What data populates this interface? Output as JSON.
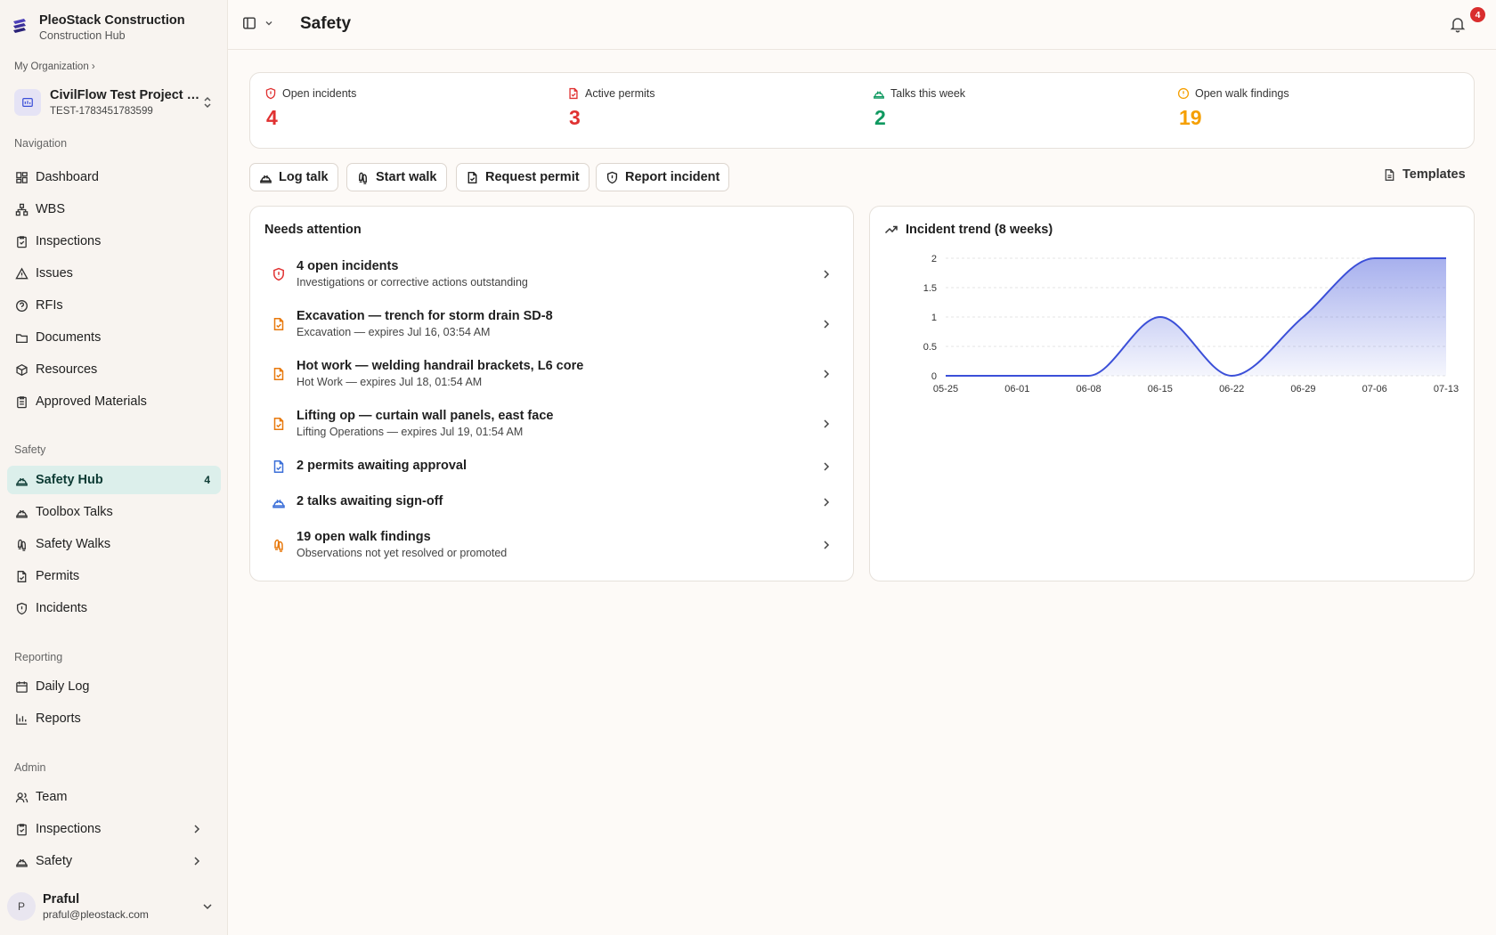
{
  "brand": {
    "name": "PleoStack Construction",
    "subtitle": "Construction Hub"
  },
  "org": {
    "crumb": "My Organization ›"
  },
  "project": {
    "name": "CivilFlow Test Project (U...",
    "code": "TEST-1783451783599"
  },
  "sidebar": {
    "navigation_label": "Navigation",
    "navigation": [
      "Dashboard",
      "WBS",
      "Inspections",
      "Issues",
      "RFIs",
      "Documents",
      "Resources",
      "Approved Materials"
    ],
    "safety_label": "Safety",
    "safety": [
      "Safety Hub",
      "Toolbox Talks",
      "Safety Walks",
      "Permits",
      "Incidents"
    ],
    "safety_hub_count": "4",
    "reporting_label": "Reporting",
    "reporting": [
      "Daily Log",
      "Reports"
    ],
    "admin_label": "Admin",
    "admin": [
      "Team",
      "Inspections",
      "Safety"
    ]
  },
  "user": {
    "initial": "P",
    "name": "Praful",
    "email": "praful@pleostack.com"
  },
  "header": {
    "title": "Safety",
    "notification_count": "4"
  },
  "stats": [
    {
      "label": "Open incidents",
      "value": "4",
      "color": "#e03131"
    },
    {
      "label": "Active permits",
      "value": "3",
      "color": "#e03131"
    },
    {
      "label": "Talks this week",
      "value": "2",
      "color": "#0f9960"
    },
    {
      "label": "Open walk findings",
      "value": "19",
      "color": "#f59f00"
    }
  ],
  "actions": {
    "log_talk": "Log talk",
    "start_walk": "Start walk",
    "request_permit": "Request permit",
    "report_incident": "Report incident",
    "templates": "Templates"
  },
  "attention": {
    "title": "Needs attention",
    "items": [
      {
        "title": "4 open incidents",
        "subtitle": "Investigations or corrective actions outstanding"
      },
      {
        "title": "Excavation — trench for storm drain SD-8",
        "subtitle": "Excavation — expires Jul 16, 03:54 AM"
      },
      {
        "title": "Hot work — welding handrail brackets, L6 core",
        "subtitle": "Hot Work — expires Jul 18, 01:54 AM"
      },
      {
        "title": "Lifting op — curtain wall panels, east face",
        "subtitle": "Lifting Operations — expires Jul 19, 01:54 AM"
      },
      {
        "title": "2 permits awaiting approval",
        "subtitle": ""
      },
      {
        "title": "2 talks awaiting sign-off",
        "subtitle": ""
      },
      {
        "title": "19 open walk findings",
        "subtitle": "Observations not yet resolved or promoted"
      }
    ]
  },
  "chart_data": {
    "type": "area",
    "title": "Incident trend (8 weeks)",
    "categories": [
      "05-25",
      "06-01",
      "06-08",
      "06-15",
      "06-22",
      "06-29",
      "07-06",
      "07-13"
    ],
    "values": [
      0,
      0,
      0,
      1,
      0,
      1,
      2,
      2
    ],
    "yticks": [
      "0",
      "0.5",
      "1",
      "1.5",
      "2"
    ],
    "ylim": [
      0,
      2
    ],
    "grid": true,
    "color": "#3b4fd8"
  }
}
